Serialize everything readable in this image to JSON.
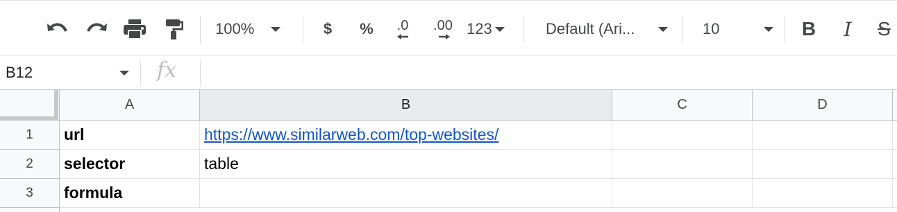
{
  "toolbar": {
    "zoom": "100%",
    "currency": "$",
    "percent": "%",
    "dec_decrease": ".0",
    "dec_increase": ".00",
    "more_formats": "123",
    "font": "Default (Ari...",
    "font_size": "10",
    "bold": "B",
    "italic": "I",
    "strike": "S"
  },
  "formula_bar": {
    "name_box": "B12",
    "fx": "fx",
    "content": ""
  },
  "grid": {
    "columns": [
      "A",
      "B",
      "C",
      "D"
    ],
    "selected_column": "B",
    "rows": [
      {
        "num": "1",
        "A": "url",
        "B": "https://www.similarweb.com/top-websites/",
        "C": "",
        "D": ""
      },
      {
        "num": "2",
        "A": "selector",
        "B": "table",
        "C": "",
        "D": ""
      },
      {
        "num": "3",
        "A": "formula",
        "B": "",
        "C": "",
        "D": ""
      }
    ]
  },
  "colors": {
    "link": "#1155cc",
    "header_bg": "#f8f9fa",
    "selected_header_bg": "#e8eaed"
  }
}
